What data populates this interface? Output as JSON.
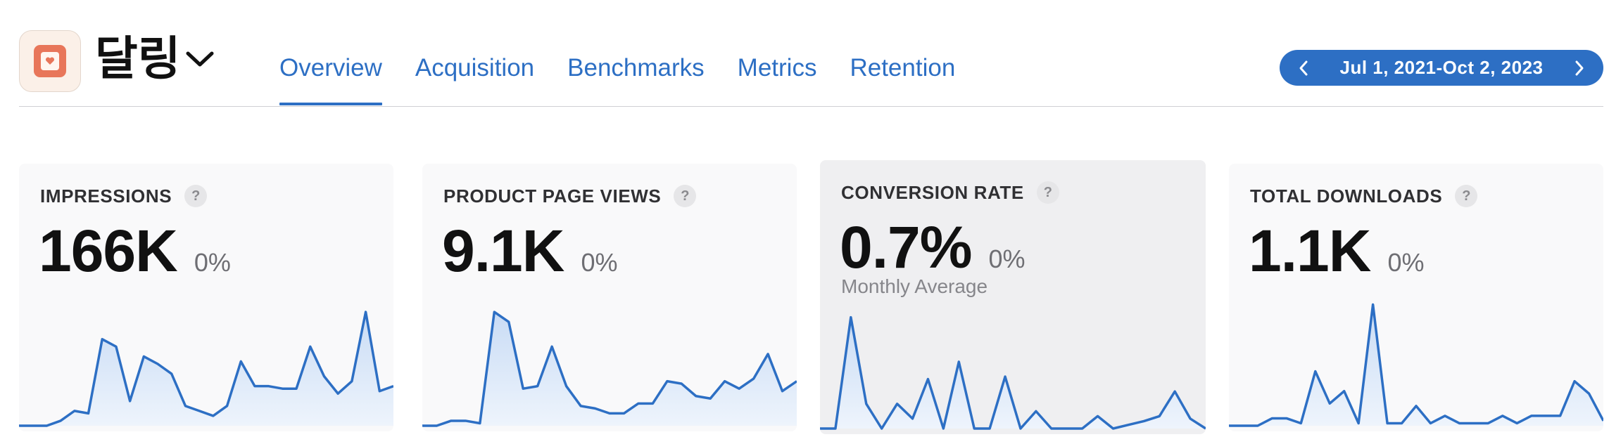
{
  "app": {
    "name": "달링",
    "icon": "app-logo-icon"
  },
  "tabs": [
    {
      "label": "Overview",
      "active": true
    },
    {
      "label": "Acquisition",
      "active": false
    },
    {
      "label": "Benchmarks",
      "active": false
    },
    {
      "label": "Metrics",
      "active": false
    },
    {
      "label": "Retention",
      "active": false
    }
  ],
  "date_range": {
    "label": "Jul 1, 2021-Oct 2, 2023",
    "prev_icon": "chevron-left-icon",
    "next_icon": "chevron-right-icon"
  },
  "colors": {
    "accent": "#2d6fc4",
    "spark_fill_top": "#c9dcf5",
    "spark_fill_bottom": "#eef4fc",
    "app_icon": "#e8765a"
  },
  "cards": [
    {
      "label": "IMPRESSIONS",
      "value": "166K",
      "delta": "0%",
      "subtitle": "",
      "selected": false,
      "sparkline": [
        0,
        0,
        0,
        4,
        12,
        10,
        70,
        64,
        20,
        56,
        50,
        42,
        16,
        12,
        8,
        16,
        52,
        32,
        32,
        30,
        30,
        64,
        40,
        26,
        36,
        92,
        28,
        32
      ]
    },
    {
      "label": "PRODUCT PAGE VIEWS",
      "value": "9.1K",
      "delta": "0%",
      "subtitle": "",
      "selected": false,
      "sparkline": [
        0,
        0,
        4,
        4,
        2,
        92,
        84,
        30,
        32,
        64,
        32,
        16,
        14,
        10,
        10,
        18,
        18,
        36,
        34,
        24,
        22,
        36,
        30,
        38,
        58,
        28,
        36
      ]
    },
    {
      "label": "CONVERSION RATE",
      "value": "0.7%",
      "delta": "0%",
      "subtitle": "Monthly Average",
      "selected": true,
      "sparkline": [
        0,
        0,
        90,
        20,
        0,
        20,
        8,
        40,
        0,
        54,
        0,
        0,
        42,
        0,
        14,
        0,
        0,
        0,
        10,
        0,
        3,
        6,
        10,
        30,
        8,
        0
      ]
    },
    {
      "label": "TOTAL DOWNLOADS",
      "value": "1.1K",
      "delta": "0%",
      "subtitle": "",
      "selected": false,
      "sparkline": [
        0,
        0,
        0,
        6,
        6,
        2,
        44,
        18,
        28,
        2,
        98,
        2,
        2,
        16,
        2,
        8,
        2,
        2,
        2,
        8,
        2,
        8,
        8,
        8,
        36,
        26,
        4
      ]
    }
  ]
}
